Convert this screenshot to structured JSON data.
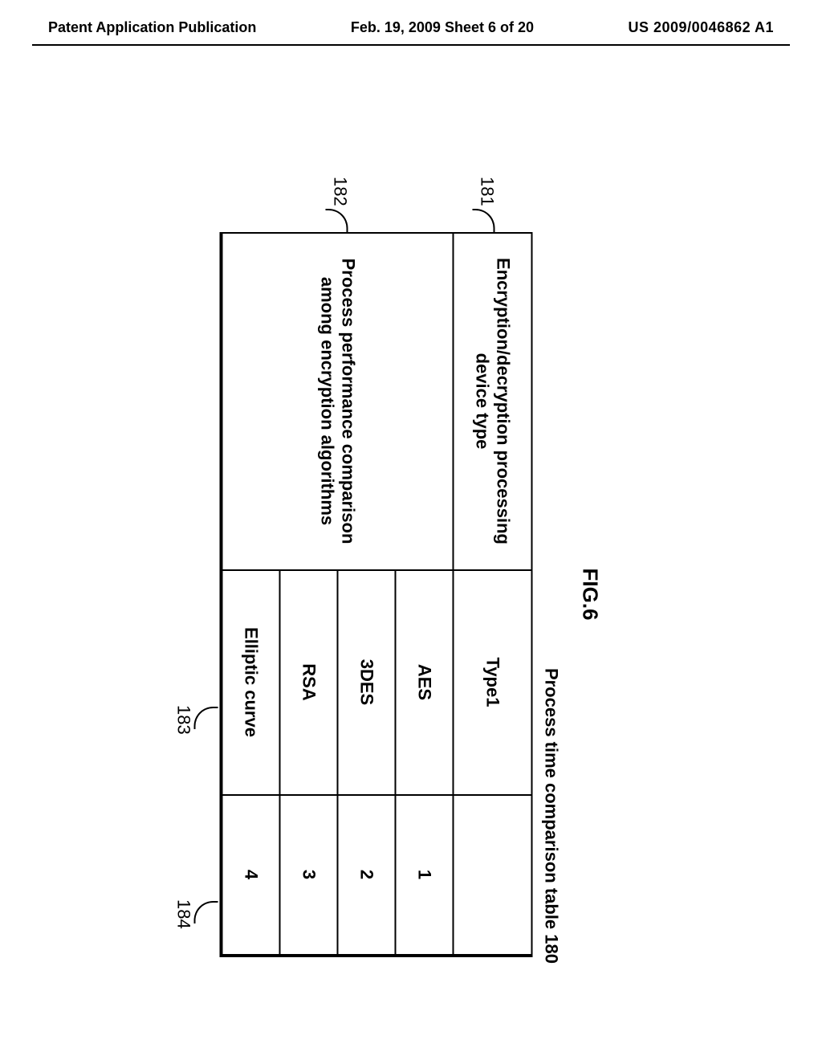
{
  "header": {
    "left": "Patent Application Publication",
    "center": "Feb. 19, 2009  Sheet 6 of 20",
    "right": "US 2009/0046862 A1"
  },
  "figure": {
    "title": "FIG.6",
    "caption": "Process time comparison table 180",
    "row1_label": "Encryption/decryption processing device type",
    "row1_col2": "Type1",
    "row1_col3": "",
    "group_label": "Process performance comparison among encryption algorithms",
    "algo1": "AES",
    "val1": "1",
    "algo2": "3DES",
    "val2": "2",
    "algo3": "RSA",
    "val3": "3",
    "algo4": "Elliptic curve",
    "val4": "4",
    "callout_181": "181",
    "callout_182": "182",
    "callout_183": "183",
    "callout_184": "184"
  }
}
